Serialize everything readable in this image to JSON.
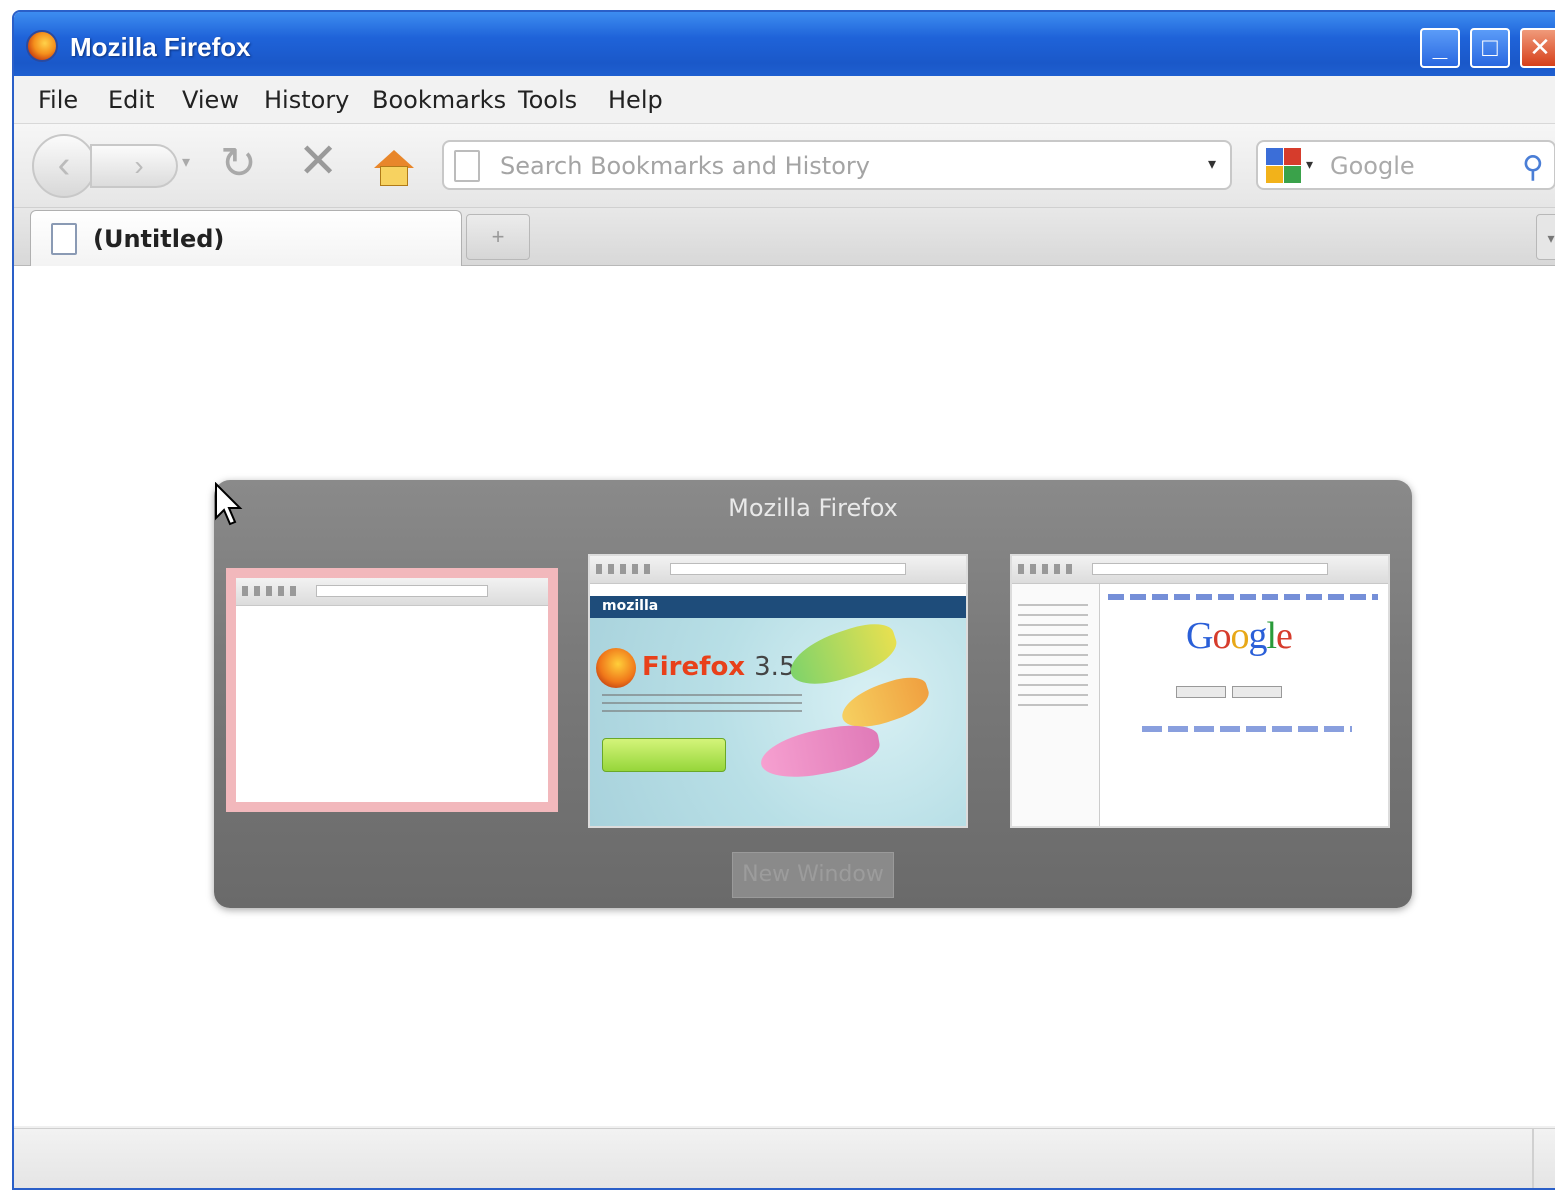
{
  "window": {
    "title": "Mozilla Firefox",
    "controls": {
      "minimize": "_",
      "maximize": "□",
      "close": "✕"
    }
  },
  "menu": {
    "items": [
      "File",
      "Edit",
      "View",
      "History",
      "Bookmarks",
      "Tools",
      "Help"
    ]
  },
  "navigation": {
    "back_icon": "‹",
    "forward_icon": "›",
    "forward_dropdown": "▾",
    "reload_icon": "↻",
    "stop_icon": "✕",
    "url_placeholder": "Search Bookmarks and History",
    "url_dropdown": "▾",
    "search_placeholder": "Google",
    "search_dropdown": "▾",
    "search_icon": "⚲"
  },
  "tabs": {
    "items": [
      {
        "label": "(Untitled)"
      }
    ],
    "new_tab_label": "+",
    "tab_list_label": "▾"
  },
  "switcher": {
    "title": "Mozilla Firefox",
    "new_window_label": "New Window",
    "thumbnails": {
      "t1": {},
      "t2": {
        "site_logo": "mozilla",
        "product": "Firefox",
        "version": "3.5"
      },
      "t3": {
        "logo": "Google"
      }
    }
  },
  "colors": {
    "titlebar": "#1f63d9",
    "switcher_bg": "#7a7a7a",
    "selected_thumb_border": "#f2b8bc"
  }
}
